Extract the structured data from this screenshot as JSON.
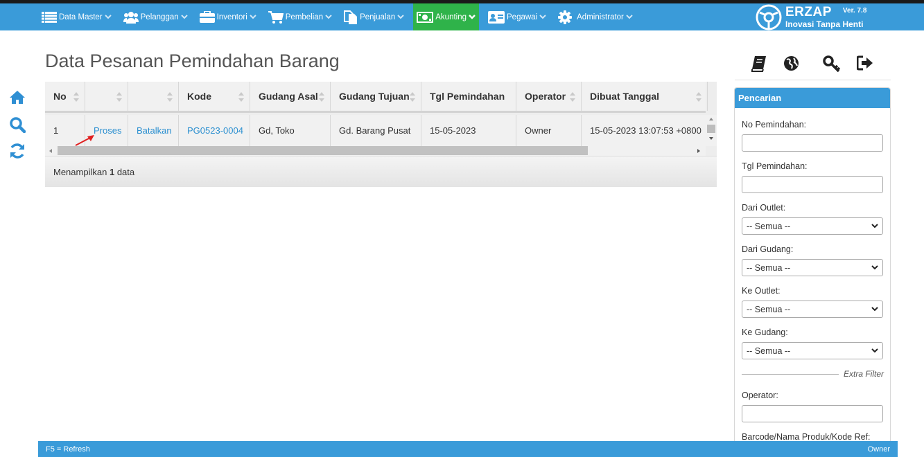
{
  "nav": {
    "items": [
      {
        "label": "Data Master",
        "icon": "list-icon"
      },
      {
        "label": "Pelanggan",
        "icon": "users-icon"
      },
      {
        "label": "Inventori",
        "icon": "briefcase-icon"
      },
      {
        "label": "Pembelian",
        "icon": "cart-icon"
      },
      {
        "label": "Penjualan",
        "icon": "document-icon"
      },
      {
        "label": "Akunting",
        "icon": "money-icon",
        "active": true
      },
      {
        "label": "Pegawai",
        "icon": "id-card-icon"
      },
      {
        "label": "Administrator",
        "icon": "gear-icon"
      }
    ]
  },
  "brand": {
    "name": "ERZAP",
    "version": "Ver. 7.8",
    "tagline": "Inovasi Tanpa Henti"
  },
  "page": {
    "title": "Data Pesanan Pemindahan Barang"
  },
  "table": {
    "columns": [
      "No",
      "",
      "",
      "Kode",
      "Gudang Asal",
      "Gudang Tujuan",
      "Tgl Pemindahan",
      "Operator",
      "Dibuat Tanggal"
    ],
    "rows": [
      {
        "no": "1",
        "process": "Proses",
        "cancel": "Batalkan",
        "code": "PG0523-0004",
        "from": "Gd, Toko",
        "to": "Gd. Barang Pusat",
        "date": "15-05-2023",
        "operator": "Owner",
        "created": "15-05-2023 13:07:53 +0800"
      }
    ],
    "footer_prefix": "Menampilkan",
    "footer_count": "1",
    "footer_suffix": "data"
  },
  "search": {
    "title": "Pencarian",
    "no_label": "No Pemindahan:",
    "date_label": "Tgl Pemindahan:",
    "from_outlet_label": "Dari Outlet:",
    "from_outlet_value": "-- Semua --",
    "from_wh_label": "Dari Gudang:",
    "from_wh_value": "-- Semua --",
    "to_outlet_label": "Ke Outlet:",
    "to_outlet_value": "-- Semua --",
    "to_wh_label": "Ke Gudang:",
    "to_wh_value": "-- Semua --",
    "extra_filter": "Extra Filter",
    "operator_label": "Operator:",
    "barcode_label": "Barcode/Nama Produk/Kode Ref:"
  },
  "status": {
    "left": "F5 = Refresh",
    "right": "Owner"
  },
  "colors": {
    "primary": "#3a9bd9",
    "active": "#2fb34a",
    "link": "#2a8fd0"
  }
}
